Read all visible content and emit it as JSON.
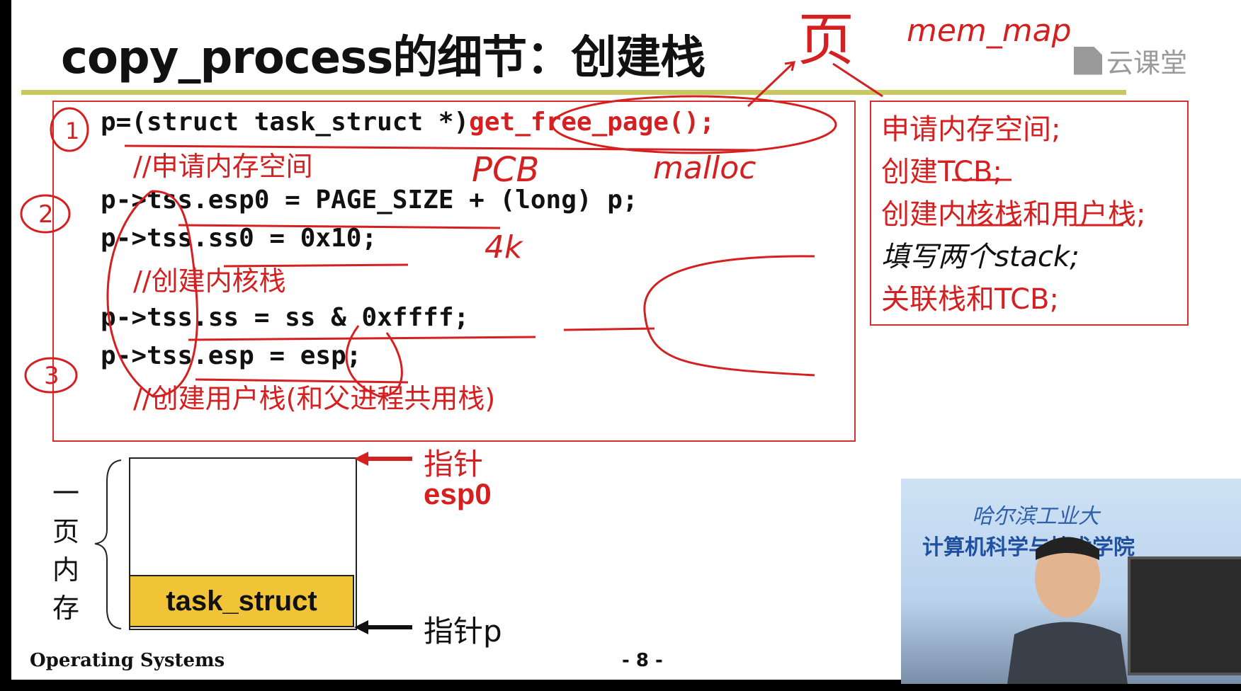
{
  "slide": {
    "title": "copy_process的细节：创建栈",
    "logo_text": "云课堂",
    "code_lines": [
      {
        "prefix": "p=(struct task_struct *)",
        "fn": "get_free_page();"
      },
      {
        "text": "p->tss.esp0 = PAGE_SIZE + (long) p;"
      },
      {
        "text": "p->tss.ss0 = 0x10;"
      },
      {
        "text": "p->tss.ss = ss & 0xffff;"
      },
      {
        "text": "p->tss.esp = esp;"
      }
    ],
    "comments": [
      "//申请内存空间",
      "//创建内核栈",
      "//创建用户栈(和父进程共用栈)"
    ],
    "steps": [
      "申请内存空间;",
      "创建TCB;",
      "创建内核栈和用户栈;",
      "填写两个stack;",
      "关联栈和TCB;"
    ],
    "memory": {
      "side_label": "一页内存",
      "block_label": "task_struct",
      "pointer_top_line1": "指针",
      "pointer_top_line2": "esp0",
      "pointer_bottom": "指针p"
    },
    "annotations": {
      "page_char": "页",
      "mem_map": "mem_map",
      "pcb": "PCB",
      "malloc": "malloc",
      "four_k": "4k",
      "circle_1": "1",
      "circle_2": "2",
      "circle_3": "3"
    },
    "footer_left": "Operating Systems",
    "footer_page": "- 8 -"
  },
  "video": {
    "banner_top": "哈尔滨工业大",
    "banner_bottom": "计算机科学与技术学院"
  },
  "colors": {
    "red": "#d42020",
    "gold": "#f0c436",
    "rule": "#c8c860"
  }
}
